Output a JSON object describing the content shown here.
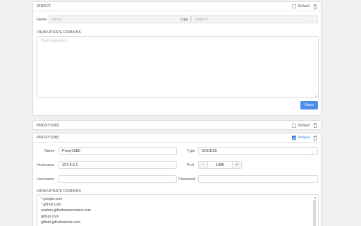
{
  "profiles": {
    "direct": {
      "header_title": "DIRECT",
      "default_label": "Default",
      "name_label": "Name",
      "name_placeholder": "Direct",
      "type_label": "Type",
      "type_value": "DIRECT",
      "domains_label": "VIEW/UPDATE DOMAINS",
      "domains_placeholder": "Shell expression",
      "save_label": "Save"
    },
    "proxy1083": {
      "header_title": "PROXY1083",
      "default_label": "Default"
    },
    "proxy1080": {
      "header_title": "PROXY1080",
      "default_label": "Default",
      "name_label": "Name",
      "name_value": "Proxy1080",
      "type_label": "Type",
      "type_value": "SOCKS5",
      "hostname_label": "Hostname",
      "hostname_value": "127.0.0.1",
      "port_label": "Port",
      "port_value": "1080",
      "port_minus": "−",
      "port_plus": "+",
      "username_label": "Username",
      "password_label": "Password",
      "domains_label": "VIEW/UPDATE DOMAINS",
      "domains": [
        "*.google.com",
        "*.github.com",
        "avatars.githubusercontent.com",
        "github.com",
        "github.githubassets.com"
      ]
    }
  },
  "colors": {
    "accent": "#3a84e8",
    "save_button": "#4b8ef0"
  }
}
